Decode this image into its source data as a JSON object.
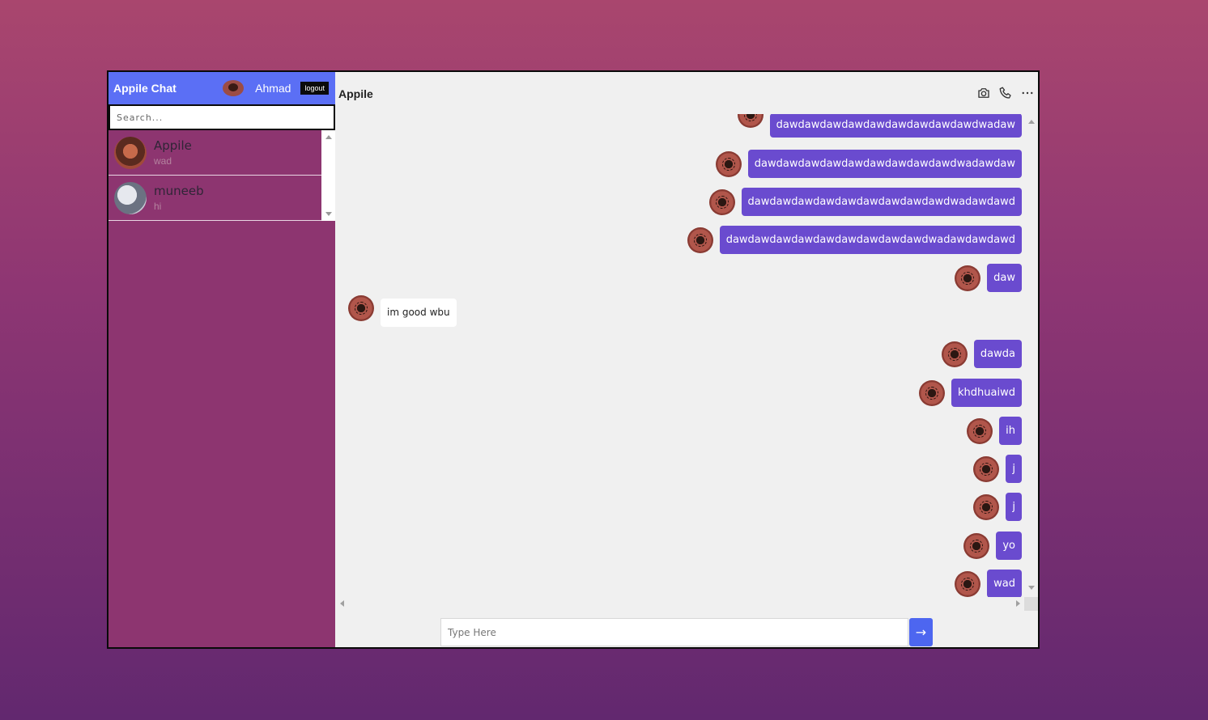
{
  "sidebar": {
    "brand": "Appile Chat",
    "user_name": "Ahmad",
    "logout_label": "logout",
    "search_placeholder": "Search...",
    "contacts": [
      {
        "name": "Appile",
        "last_message": "wad"
      },
      {
        "name": "muneeb",
        "last_message": "hi"
      }
    ]
  },
  "chat": {
    "title": "Appile",
    "messages": [
      {
        "dir": "out",
        "text": "dawdawdawdawdawdawdawdawdawdwadaw"
      },
      {
        "dir": "out",
        "text": "dawdawdawdawdawdawdawdawdawdwadawdaw"
      },
      {
        "dir": "out",
        "text": "dawdawdawdawdawdawdawdawdawdwadawdawd"
      },
      {
        "dir": "out",
        "text": "dawdawdawdawdawdawdawdawdawdwadawdawdawd"
      },
      {
        "dir": "out",
        "text": "daw"
      },
      {
        "dir": "in",
        "text": "im good wbu"
      },
      {
        "dir": "out",
        "text": "dawda"
      },
      {
        "dir": "out",
        "text": "khdhuaiwd"
      },
      {
        "dir": "out",
        "text": "ih"
      },
      {
        "dir": "out",
        "text": "j"
      },
      {
        "dir": "out",
        "text": "j"
      },
      {
        "dir": "out",
        "text": "yo"
      },
      {
        "dir": "out",
        "text": "wad"
      }
    ],
    "input_placeholder": "Type Here",
    "send_label": "→"
  },
  "icons": {
    "camera": "camera-icon",
    "phone": "phone-icon",
    "more": "more-horizontal-icon",
    "send": "arrow-right-icon"
  },
  "colors": {
    "header_blue": "#5b6ff5",
    "sidebar_bg": "#8d3570",
    "outgoing_bubble": "#6a4bcf",
    "incoming_bubble": "#ffffff",
    "send_button": "#4d66f0"
  }
}
